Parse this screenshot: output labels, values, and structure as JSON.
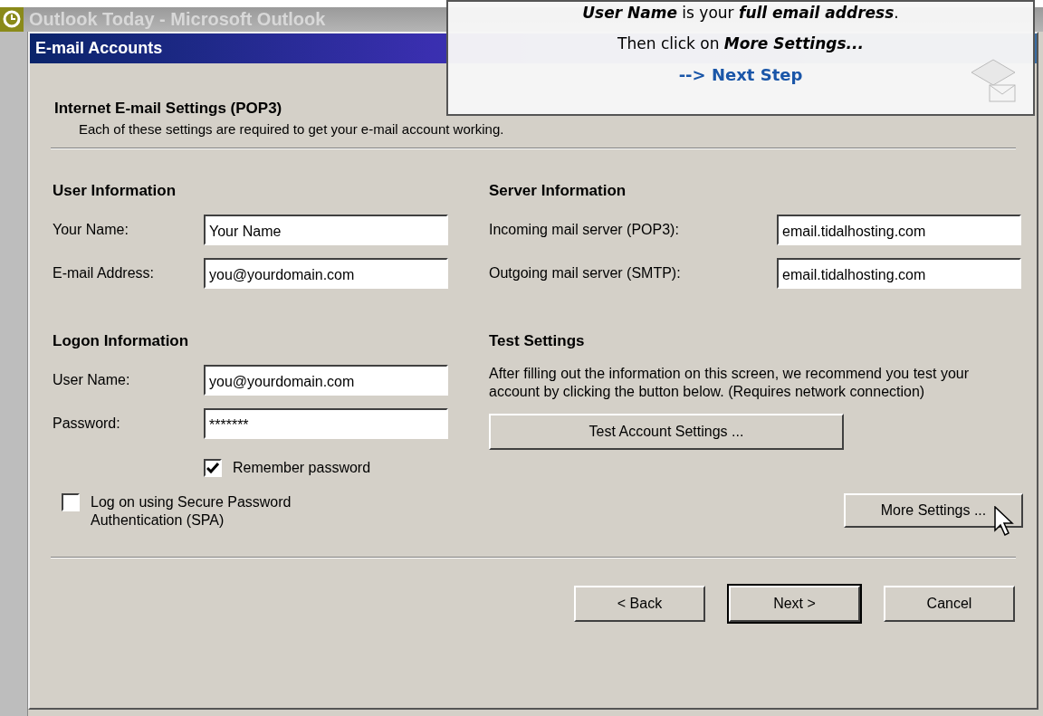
{
  "app_window": {
    "title": "Outlook Today - Microsoft Outlook"
  },
  "callout": {
    "lines": [
      "**User Name** is your **full email address**.",
      "Then click on **More Settings...**"
    ],
    "link": "--> Next Step"
  },
  "dialog": {
    "title": "E-mail Accounts",
    "heading": "Internet E-mail Settings (POP3)",
    "subheading": "Each of these settings are required to get your e-mail account working.",
    "user_information": {
      "title": "User Information",
      "fields": [
        {
          "label": "Your Name:",
          "value": "Your Name"
        },
        {
          "label": "E-mail Address:",
          "value": "you@yourdomain.com"
        }
      ]
    },
    "server_information": {
      "title": "Server Information",
      "fields": [
        {
          "label": "Incoming mail server (POP3):",
          "value": "email.tidalhosting.com"
        },
        {
          "label": "Outgoing mail server (SMTP):",
          "value": "email.tidalhosting.com"
        }
      ]
    },
    "logon_information": {
      "title": "Logon Information",
      "fields": [
        {
          "label": "User Name:",
          "value": "you@yourdomain.com"
        },
        {
          "label": "Password:",
          "value": "*******"
        }
      ],
      "remember_password": {
        "label": "Remember password",
        "checked": true
      },
      "spa": {
        "label": "Log on using Secure Password Authentication (SPA)",
        "checked": false
      }
    },
    "test_settings": {
      "title": "Test Settings",
      "text": "After filling out the information on this screen, we recommend you test your account by clicking the button below. (Requires network connection)",
      "button": "Test Account Settings ..."
    },
    "more_settings_button": "More Settings ...",
    "buttons": [
      {
        "label": "< Back",
        "default": false
      },
      {
        "label": "Next >",
        "default": true
      },
      {
        "label": "Cancel",
        "default": false
      }
    ]
  }
}
